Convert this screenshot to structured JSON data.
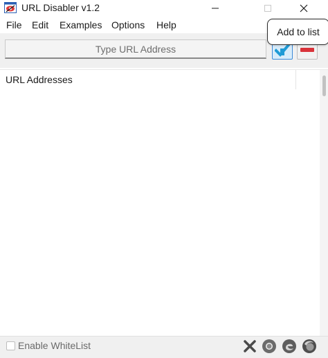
{
  "window": {
    "title": "URL Disabler v1.2",
    "min_glyph": "—",
    "max_glyph": "□",
    "close_glyph": "✕"
  },
  "menu": [
    {
      "label": "File"
    },
    {
      "label": "Edit"
    },
    {
      "label": "Examples"
    },
    {
      "label": "Options"
    },
    {
      "label": "Help"
    }
  ],
  "input": {
    "placeholder": "Type URL Address",
    "value": ""
  },
  "tooltip": {
    "text": "Add to list"
  },
  "list": {
    "header": "URL Addresses",
    "items": []
  },
  "statusbar": {
    "whitelist_label": "Enable WhiteList",
    "whitelist_checked": false
  },
  "icons": {
    "app": "url-disabler-app-icon",
    "add": "add-url-icon",
    "remove": "remove-url-icon",
    "clear": "clear-x-icon",
    "browser1": "chrome-browser-icon",
    "browser2": "edge-browser-icon",
    "browser3": "firefox-browser-icon"
  },
  "colors": {
    "add_button_bg": "#d8ecfa",
    "add_button_border": "#3b8ad9",
    "remove_red": "#d9333a",
    "check_teal": "#1f9bd6"
  }
}
